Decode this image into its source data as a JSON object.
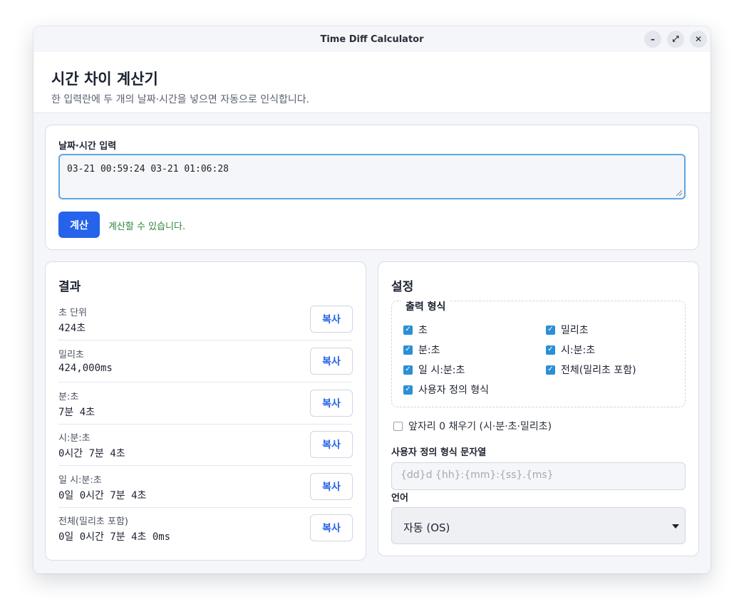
{
  "window": {
    "title": "Time Diff Calculator"
  },
  "header": {
    "title": "시간 차이 계산기",
    "subtitle": "한 입력란에 두 개의 날짜·시간을 넣으면 자동으로 인식합니다."
  },
  "input": {
    "label": "날짜·시간 입력",
    "value": "03-21 00:59:24 03-21 01:06:28",
    "calc_label": "계산",
    "status": "계산할 수 있습니다.",
    "status_color": "#2e8540"
  },
  "result": {
    "title": "결과",
    "copy_label": "복사",
    "rows": [
      {
        "label": "초 단위",
        "value": "424초"
      },
      {
        "label": "밀리초",
        "value": "424,000ms"
      },
      {
        "label": "분:초",
        "value": "7분 4초"
      },
      {
        "label": "시:분:초",
        "value": "0시간 7분 4초"
      },
      {
        "label": "일 시:분:초",
        "value": "0일 0시간 7분 4초"
      },
      {
        "label": "전체(밀리초 포함)",
        "value": "0일 0시간 7분 4초 0ms"
      }
    ]
  },
  "settings": {
    "title": "설정",
    "format_legend": "출력 형식",
    "formats": [
      {
        "label": "초",
        "checked": true
      },
      {
        "label": "밀리초",
        "checked": true
      },
      {
        "label": "분:초",
        "checked": true
      },
      {
        "label": "시:분:초",
        "checked": true
      },
      {
        "label": "일 시:분:초",
        "checked": true
      },
      {
        "label": "전체(밀리초 포함)",
        "checked": true
      },
      {
        "label": "사용자 정의 형식",
        "checked": true
      }
    ],
    "zero_pad": {
      "label": "앞자리 0 채우기 (시·분·초·밀리초)",
      "checked": false
    },
    "custom_format": {
      "label": "사용자 정의 형식 문자열",
      "placeholder": "{dd}d {hh}:{mm}:{ss}.{ms}"
    },
    "language": {
      "label": "언어",
      "selected": "자동 (OS)"
    }
  },
  "colors": {
    "accent": "#2563eb",
    "checkbox": "#2b8fd6",
    "focus_border": "#5aa6e6"
  }
}
